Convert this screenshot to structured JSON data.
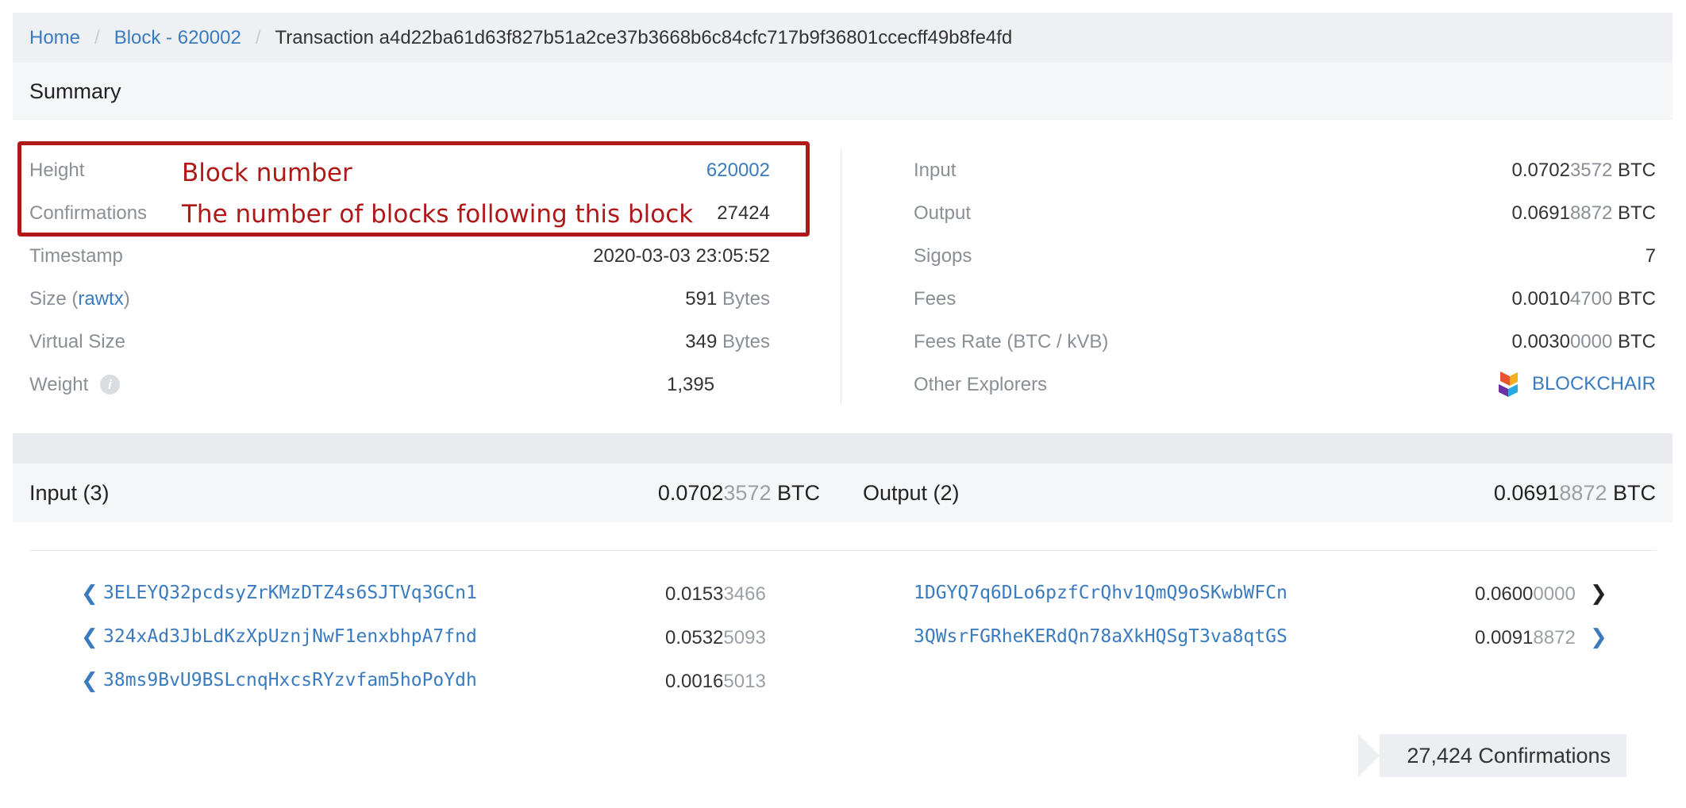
{
  "breadcrumb": {
    "home": "Home",
    "block": "Block - 620002",
    "separator": "/",
    "current": "Transaction a4d22ba61d63f827b51a2ce37b3668b6c84cfc717b9f36801ccecff49b8fe4fd"
  },
  "summary": {
    "title": "Summary",
    "left": {
      "height_label": "Height",
      "height_value": "620002",
      "confirmations_label": "Confirmations",
      "confirmations_value": "27424",
      "timestamp_label": "Timestamp",
      "timestamp_value": "2020-03-03 23:05:52",
      "size_label_prefix": "Size (",
      "size_label_link": "rawtx",
      "size_label_suffix": ")",
      "size_value": "591",
      "size_unit": "Bytes",
      "vsize_label": "Virtual Size",
      "vsize_value": "349",
      "vsize_unit": "Bytes",
      "weight_label": "Weight",
      "weight_value": "1,395"
    },
    "right": {
      "input_label": "Input",
      "input_value_strong": "0.0702",
      "input_value_light": "3572",
      "output_label": "Output",
      "output_value_strong": "0.0691",
      "output_value_light": "8872",
      "sigops_label": "Sigops",
      "sigops_value": "7",
      "fees_label": "Fees",
      "fees_value_strong": "0.0010",
      "fees_value_light": "4700",
      "feerate_label": "Fees Rate (BTC / kVB)",
      "feerate_value_strong": "0.0030",
      "feerate_value_light": "0000",
      "explorers_label": "Other Explorers",
      "explorers_value": "BLOCKCHAIR",
      "unit": "BTC"
    }
  },
  "callouts": {
    "height": "Block number",
    "confirmations": "The number of blocks following this block"
  },
  "io": {
    "input_title": "Input (3)",
    "input_total_strong": "0.0702",
    "input_total_light": "3572",
    "output_title": "Output (2)",
    "output_total_strong": "0.0691",
    "output_total_light": "8872",
    "unit": "BTC",
    "inputs": [
      {
        "address": "3ELEYQ32pcdsyZrKMzDTZ4s6SJTVq3GCn1",
        "amount_strong": "0.0153",
        "amount_light": "3466"
      },
      {
        "address": "324xAd3JbLdKzXpUznjNwF1enxbhpA7fnd",
        "amount_strong": "0.0532",
        "amount_light": "5093"
      },
      {
        "address": "38ms9BvU9BSLcnqHxcsRYzvfam5hoPoYdh",
        "amount_strong": "0.0016",
        "amount_light": "5013"
      }
    ],
    "outputs": [
      {
        "address": "1DGYQ7q6DLo6pzfCrQhv1QmQ9oSKwbWFCn",
        "amount_strong": "0.0600",
        "amount_light": "0000",
        "chevron_color": "#222222"
      },
      {
        "address": "3QWsrFGRheKERdQn78aXkHQSgT3va8qtGS",
        "amount_strong": "0.0091",
        "amount_light": "8872",
        "chevron_color": "#3a7bbf"
      }
    ]
  },
  "confirmations_badge": "27,424 Confirmations",
  "icons": {
    "input_chevron": "chevron-left-icon",
    "output_chevron": "chevron-right-icon",
    "blockchair": "blockchair-logo-icon",
    "info": "info-icon"
  }
}
